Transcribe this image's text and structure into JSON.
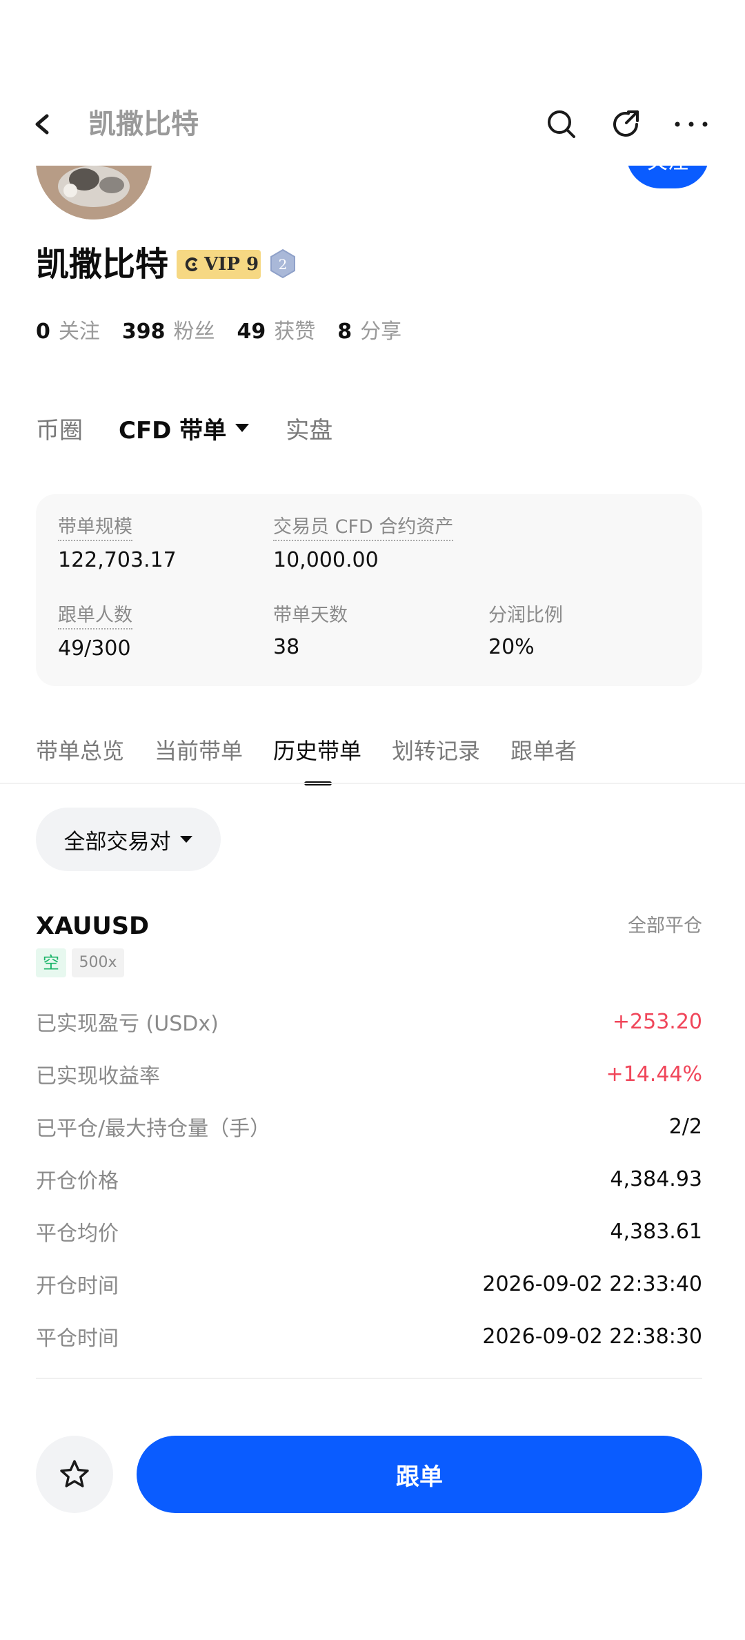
{
  "header": {
    "title": "凯撒比特",
    "back_icon": "back-arrow-icon",
    "search_icon": "search-icon",
    "share_icon": "share-icon",
    "more_icon": "more-icon"
  },
  "profile": {
    "name": "凯撒比特",
    "follow_label": "关注",
    "vip_label": "VIP 9",
    "level": "2",
    "stats": [
      {
        "num": "0",
        "label": "关注"
      },
      {
        "num": "398",
        "label": "粉丝"
      },
      {
        "num": "49",
        "label": "获赞"
      },
      {
        "num": "8",
        "label": "分享"
      }
    ]
  },
  "category_tabs": [
    {
      "label": "币圈"
    },
    {
      "label": "CFD 带单"
    },
    {
      "label": "实盘"
    }
  ],
  "summary": {
    "scale_label": "带单规模",
    "scale_value": "122,703.17",
    "asset_label": "交易员 CFD 合约资产",
    "asset_value": "10,000.00",
    "followers_label": "跟单人数",
    "followers_value": "49/300",
    "days_label": "带单天数",
    "days_value": "38",
    "share_label": "分润比例",
    "share_value": "20%"
  },
  "sub_tabs": [
    {
      "label": "带单总览"
    },
    {
      "label": "当前带单"
    },
    {
      "label": "历史带单"
    },
    {
      "label": "划转记录"
    },
    {
      "label": "跟单者"
    }
  ],
  "filter": {
    "label": "全部交易对"
  },
  "trade": {
    "symbol": "XAUUSD",
    "close_all": "全部平仓",
    "side_tag": "空",
    "leverage_tag": "500x",
    "rows": [
      {
        "label": "已实现盈亏 (USDx)",
        "value": "+253.20"
      },
      {
        "label": "已实现收益率",
        "value": "+14.44%"
      },
      {
        "label": "已平仓/最大持仓量（手）",
        "value": "2/2"
      },
      {
        "label": "开仓价格",
        "value": "4,384.93"
      },
      {
        "label": "平仓均价",
        "value": "4,383.61"
      },
      {
        "label": "开仓时间",
        "value": "2026-09-02 22:33:40"
      },
      {
        "label": "平仓时间",
        "value": "2026-09-02 22:38:30"
      }
    ]
  },
  "bottom": {
    "star_icon": "star-icon",
    "follow_trade_label": "跟单"
  },
  "colors": {
    "primary": "#0a5cff",
    "profit": "#f0465a",
    "short_tag": "#1cb56a",
    "vip_gold": "#f6d883"
  }
}
